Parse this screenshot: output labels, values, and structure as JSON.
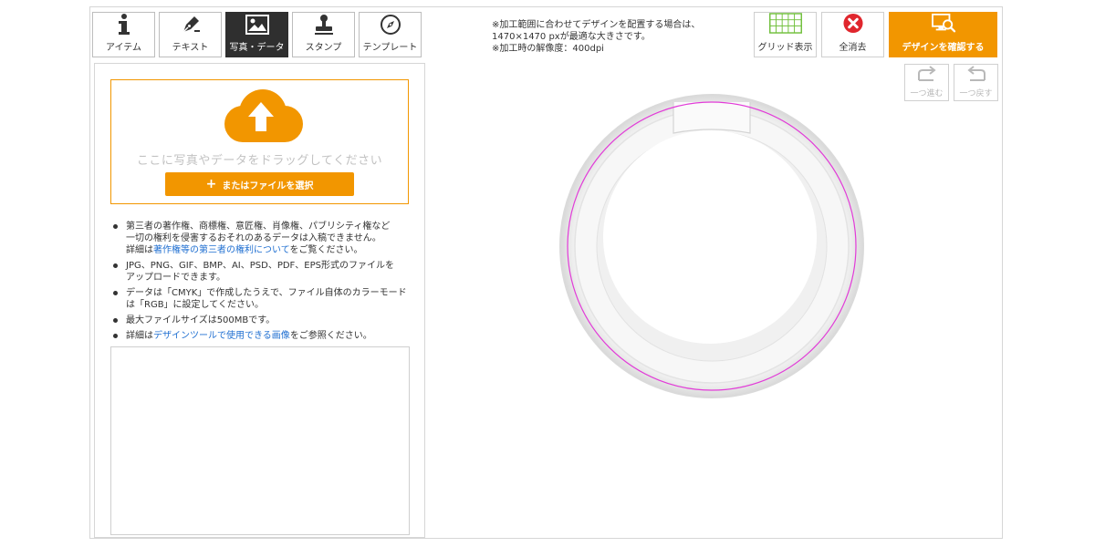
{
  "tabs": [
    {
      "label": "アイテム",
      "icon": "info-icon"
    },
    {
      "label": "テキスト",
      "icon": "pen-icon"
    },
    {
      "label": "写真・データ",
      "icon": "image-icon",
      "active": true
    },
    {
      "label": "スタンプ",
      "icon": "stamp-icon"
    },
    {
      "label": "テンプレート",
      "icon": "compass-icon"
    }
  ],
  "upload": {
    "drop_text": "ここに写真やデータをドラッグしてください",
    "select_label": "またはファイルを選択"
  },
  "notes": {
    "note1_line1": "第三者の著作権、商標権、意匠権、肖像権、パブリシティ権など",
    "note1_line2": "一切の権利を侵害するおそれのあるデータは入稿できません。",
    "note1_prefix": "詳細は",
    "note1_link": "著作権等の第三者の権利について",
    "note1_suffix": "をご覧ください。",
    "note2_line1": "JPG、PNG、GIF、BMP、AI、PSD、PDF、EPS形式のファイルを",
    "note2_line2": "アップロードできます。",
    "note3_line1": "データは「CMYK」で作成したうえで、ファイル自体のカラーモード",
    "note3_line2": "は「RGB」に設定してください。",
    "note4": "最大ファイルサイズは500MBです。",
    "note5_prefix": "詳細は",
    "note5_link": "デザインツールで使用できる画像",
    "note5_suffix": "をご参照ください。"
  },
  "info": {
    "line1": "※加工範囲に合わせてデザインを配置する場合は、",
    "line2": "1470×1470 pxが最適な大きさです。",
    "line3": "※加工時の解像度：400dpi"
  },
  "toolbar": {
    "grid_label": "グリッド表示",
    "clear_label": "全消去",
    "confirm_label": "デザインを確認する",
    "redo_label": "一つ進む",
    "undo_label": "一つ戻す"
  },
  "colors": {
    "accent": "#f29600",
    "active_tab": "#2f2f2f",
    "link": "#1f6fd1",
    "guide": "#e23bd8",
    "clear_icon": "#e0262d",
    "grid_icon": "#6fbf3a"
  }
}
